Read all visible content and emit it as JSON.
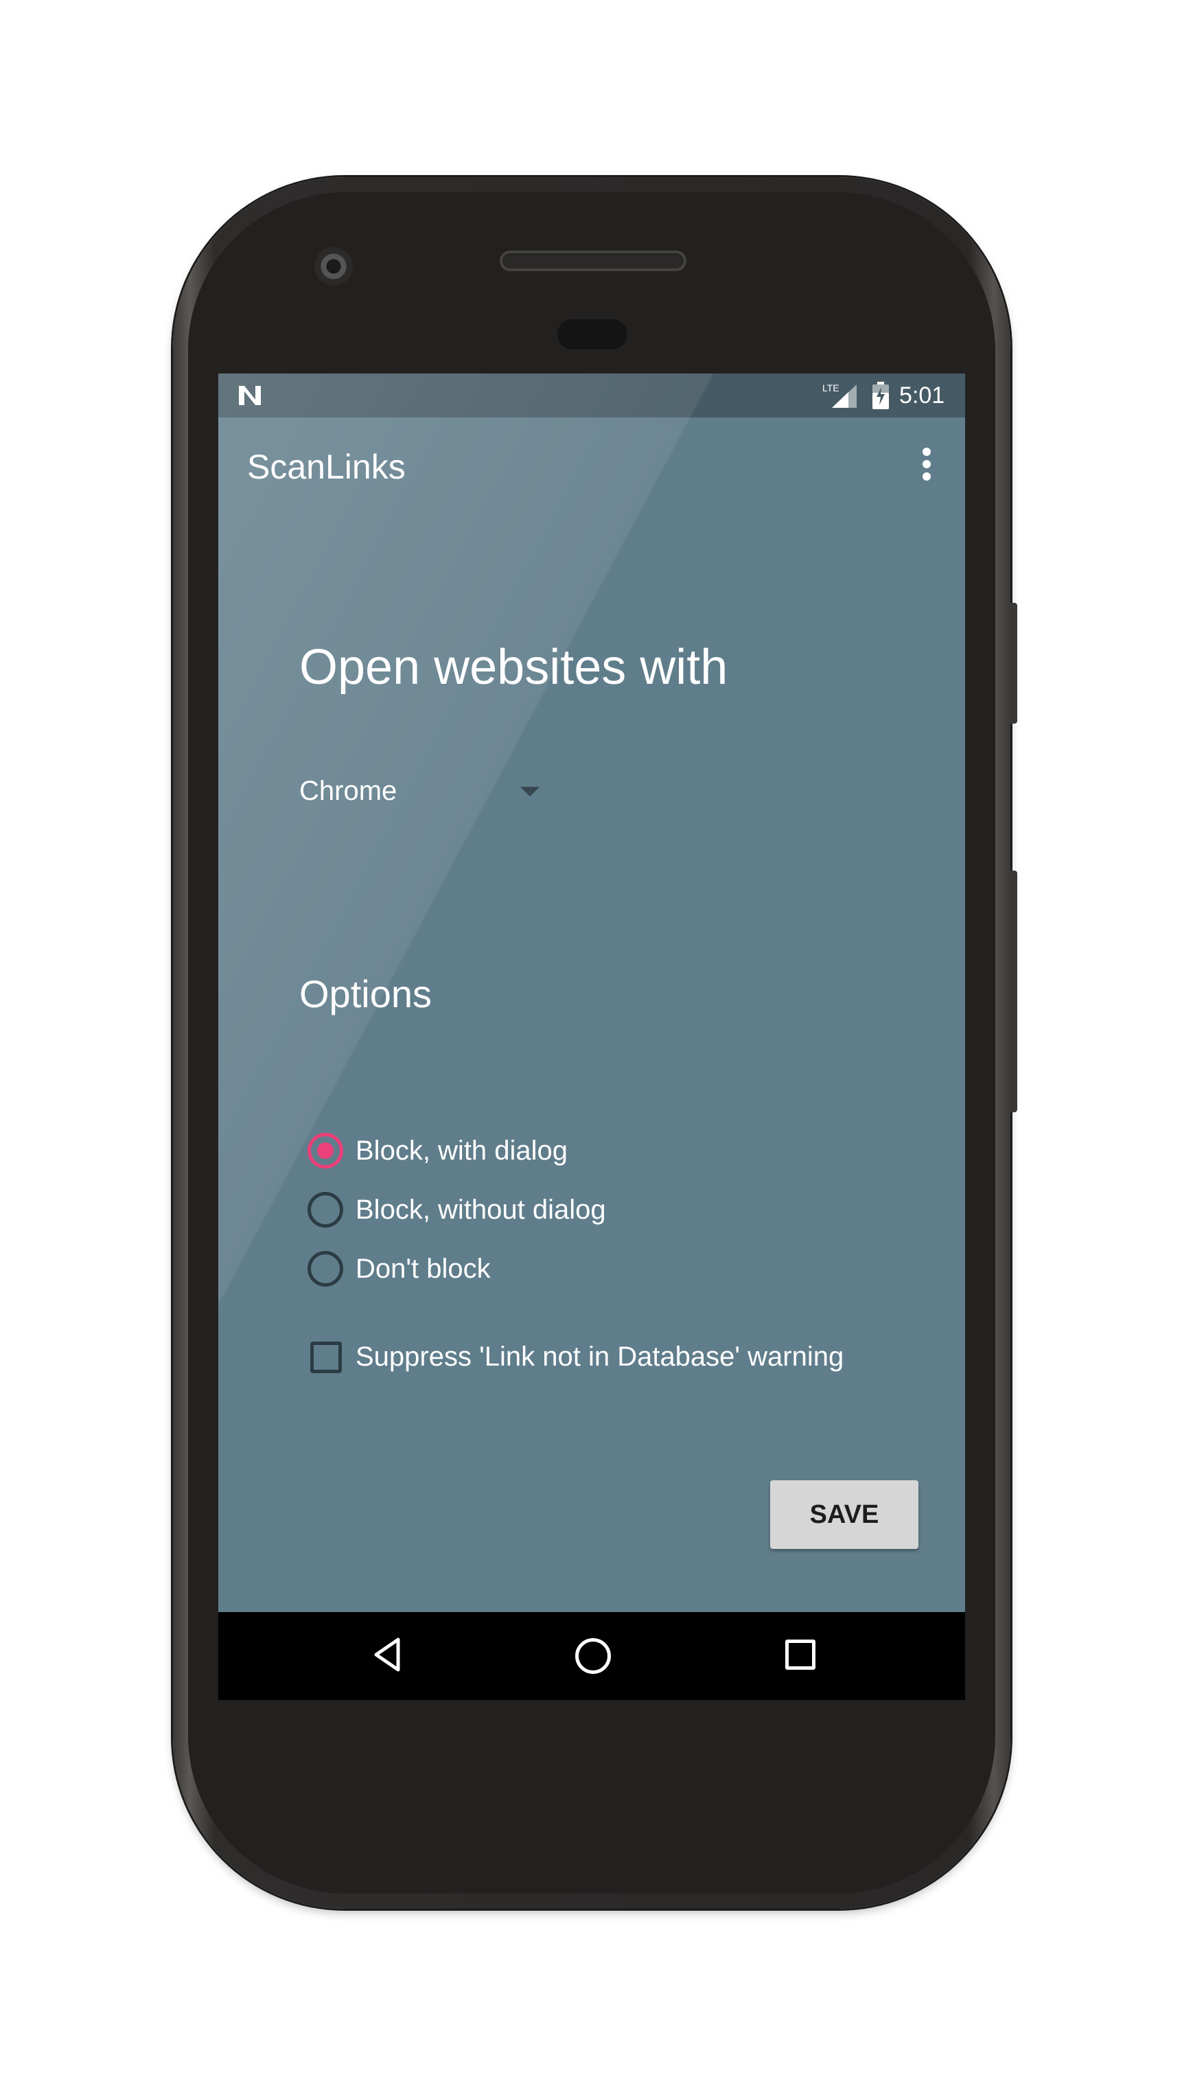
{
  "status_bar": {
    "notification_icon": "n-icon",
    "signal_label": "LTE",
    "time": "5:01"
  },
  "app_bar": {
    "title": "ScanLinks",
    "menu_icon": "overflow-menu-icon"
  },
  "main": {
    "heading": "Open websites with",
    "browser_select": {
      "selected": "Chrome"
    },
    "options_heading": "Options",
    "block_options": [
      {
        "label": "Block, with dialog",
        "checked": true
      },
      {
        "label": "Block, without dialog",
        "checked": false
      },
      {
        "label": "Don't block",
        "checked": false
      }
    ],
    "suppress_warning": {
      "label": "Suppress 'Link not in Database' warning",
      "checked": false
    },
    "save_label": "SAVE"
  },
  "nav_bar": {
    "back_icon": "back-icon",
    "home_icon": "home-icon",
    "recents_icon": "recents-icon"
  },
  "colors": {
    "background": "#607d8b",
    "status_bar": "#455a64",
    "accent": "#ec407a",
    "button": "#d6d6d6"
  }
}
